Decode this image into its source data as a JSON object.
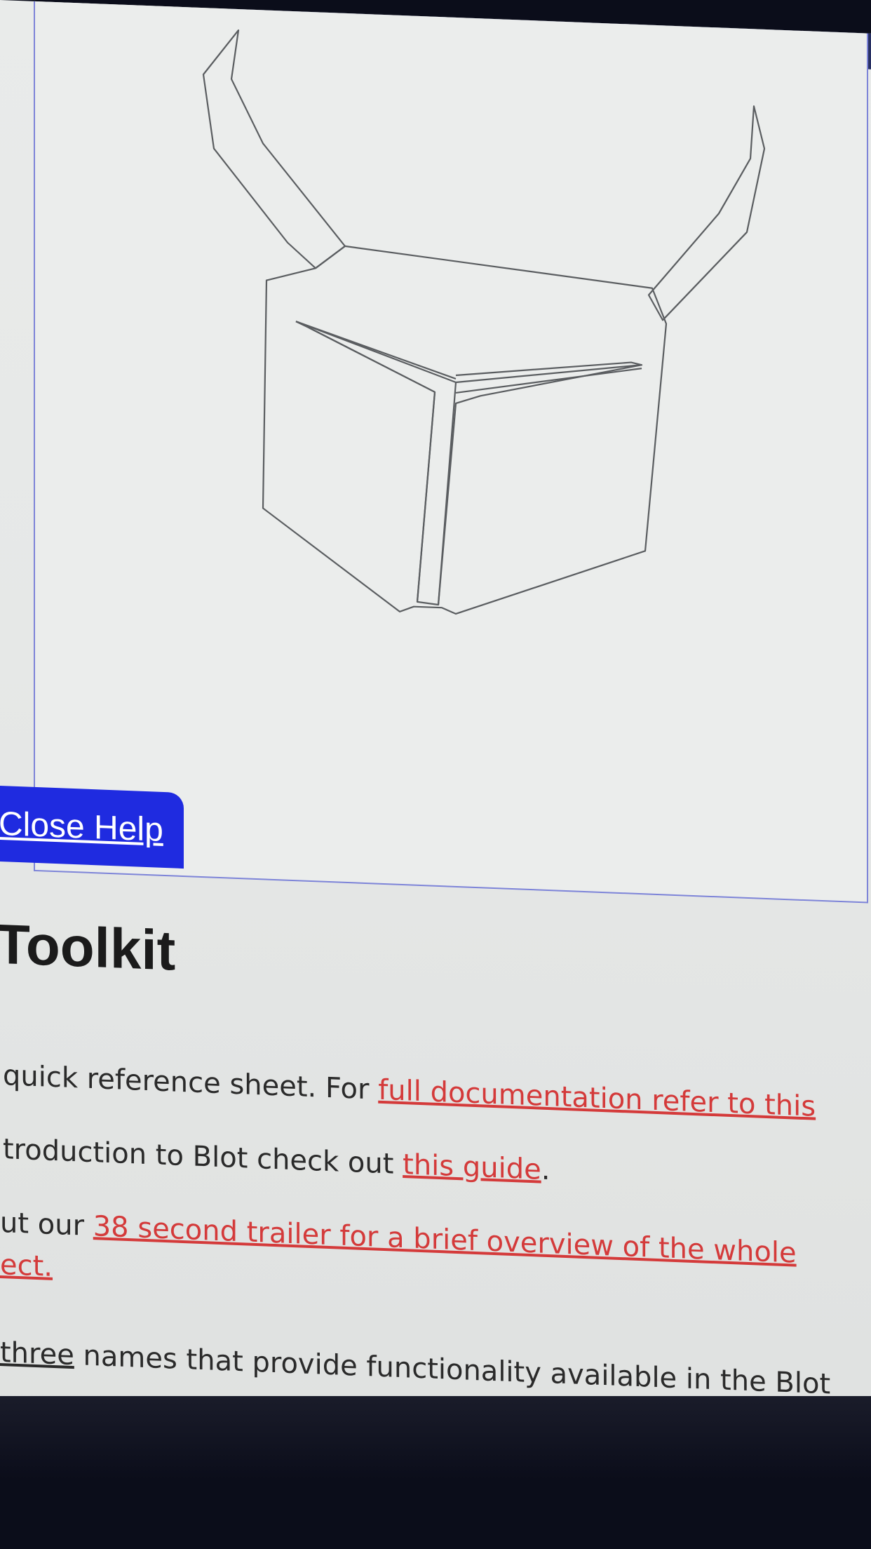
{
  "help_panel": {
    "close_label": "Close Help"
  },
  "reference": {
    "title": "Toolkit",
    "p1_text": "quick reference sheet. For ",
    "p1_link": "full documentation refer to this",
    "p2_text": "troduction to Blot check out ",
    "p2_link": "this guide",
    "p2_after": ".",
    "p3_text": "ut our ",
    "p3_link": "38 second trailer for a brief overview of the whole",
    "p3_link_cont": "ect.",
    "p4_link": "three",
    "p4_text": " names that provide functionality available in the Blot"
  },
  "colors": {
    "accent_blue": "#1f2be0",
    "link_red": "#d43a3a",
    "frame_border": "#7d84d8",
    "header_navy": "#283063"
  },
  "icons": {
    "drawing": "horned-helmet-line-drawing"
  }
}
